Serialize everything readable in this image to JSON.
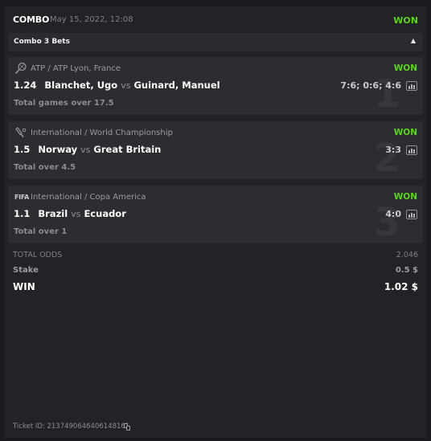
{
  "header": {
    "type": "COMBO",
    "date": "May 15, 2022, 12:08",
    "status": "WON"
  },
  "combo_bar": {
    "label": "Combo 3 Bets",
    "chevron": "▲"
  },
  "bets": [
    {
      "sport_icon": "tennis-icon",
      "league": "ATP / ATP Lyon, France",
      "status": "WON",
      "odds": "1.24",
      "home": "Blanchet, Ugo",
      "vs": "vs",
      "away": "Guinard, Manuel",
      "score": "7:6; 0:6; 4:6",
      "market": "Total games over 17.5",
      "index": "1"
    },
    {
      "sport_icon": "cricket-icon",
      "league": "International / World Championship",
      "status": "WON",
      "odds": "1.5",
      "home": "Norway",
      "vs": "vs",
      "away": "Great Britain",
      "score": "3:3",
      "market": "Total over 4.5",
      "index": "2"
    },
    {
      "sport_icon": "fifa-icon",
      "icon_text": "FIFA",
      "league": "International / Copa America",
      "status": "WON",
      "odds": "1.1",
      "home": "Brazil",
      "vs": "vs",
      "away": "Ecuador",
      "score": "4:0",
      "market": "Total over 1",
      "index": "3"
    }
  ],
  "totals": {
    "odds_label": "TOTAL ODDS",
    "odds_value": "2.046",
    "stake_label": "Stake",
    "stake_value": "0.5 $",
    "win_label": "WIN",
    "win_value": "1.02 $"
  },
  "ticket": {
    "label": "Ticket ID: 2137490646406148161"
  },
  "colors": {
    "won": "#5cd31f",
    "background": "#1a1b1e",
    "card": "#222326",
    "bet_bg": "#2c2d31"
  }
}
